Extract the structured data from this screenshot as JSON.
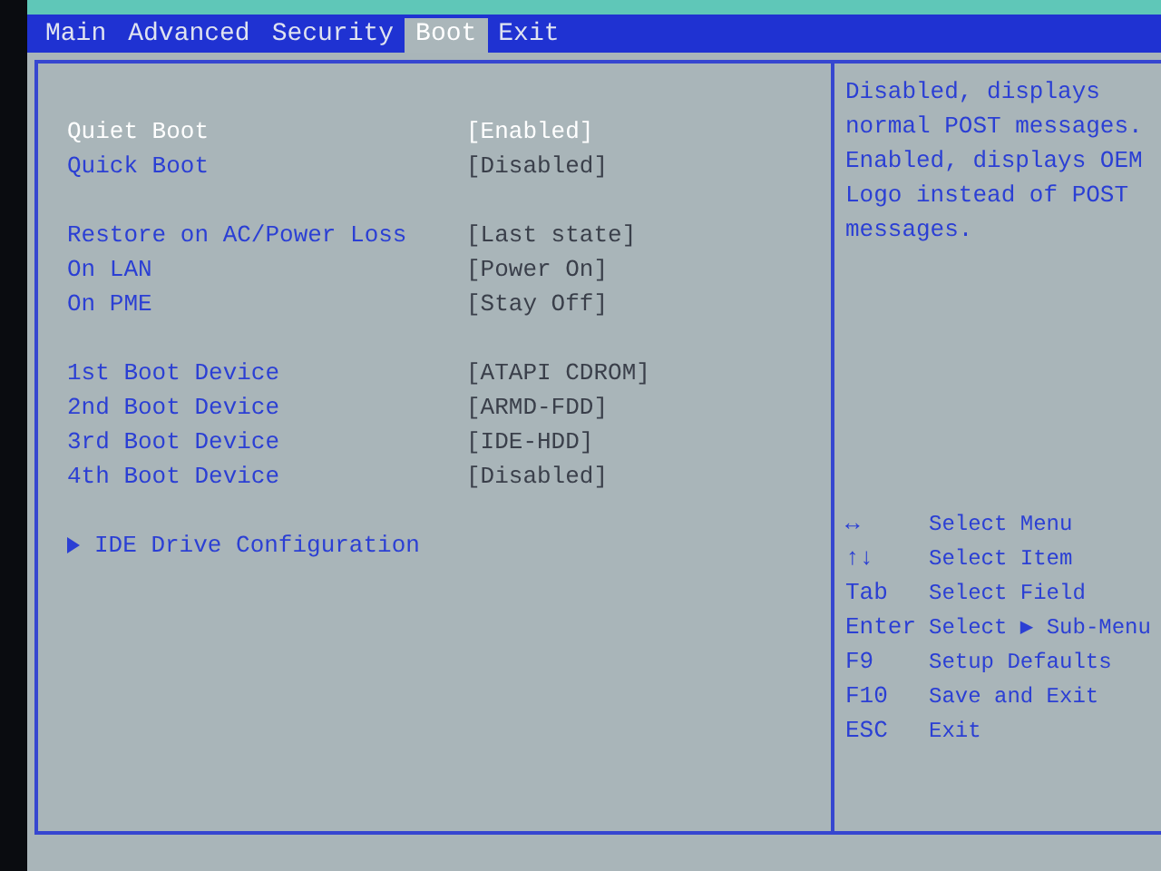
{
  "menu_bar": {
    "tabs": [
      {
        "label": "Main",
        "selected": false
      },
      {
        "label": "Advanced",
        "selected": false
      },
      {
        "label": "Security",
        "selected": false
      },
      {
        "label": "Boot",
        "selected": true
      },
      {
        "label": "Exit",
        "selected": false
      }
    ]
  },
  "settings": {
    "groups": [
      {
        "items": [
          {
            "kind": "option",
            "label": "Quiet Boot",
            "value": "[Enabled]",
            "selected": true
          },
          {
            "kind": "option",
            "label": "Quick Boot",
            "value": "[Disabled]",
            "selected": false
          }
        ]
      },
      {
        "items": [
          {
            "kind": "option",
            "label": "Restore on AC/Power Loss",
            "value": "[Last state]",
            "selected": false
          },
          {
            "kind": "option",
            "label": "On LAN",
            "value": "[Power On]",
            "selected": false
          },
          {
            "kind": "option",
            "label": "On PME",
            "value": "[Stay Off]",
            "selected": false
          }
        ]
      },
      {
        "items": [
          {
            "kind": "option",
            "label": "1st Boot Device",
            "value": "[ATAPI CDROM]",
            "selected": false
          },
          {
            "kind": "option",
            "label": "2nd Boot Device",
            "value": "[ARMD-FDD]",
            "selected": false
          },
          {
            "kind": "option",
            "label": "3rd Boot Device",
            "value": "[IDE-HDD]",
            "selected": false
          },
          {
            "kind": "option",
            "label": "4th Boot Device",
            "value": "[Disabled]",
            "selected": false
          }
        ]
      },
      {
        "items": [
          {
            "kind": "submenu",
            "label": "IDE Drive Configuration",
            "selected": false
          }
        ]
      }
    ]
  },
  "help": {
    "text": "Disabled, displays normal POST messages. Enabled, displays OEM Logo instead of POST messages.",
    "keys": [
      {
        "key": "↔",
        "action": "Select Menu"
      },
      {
        "key": "↑↓",
        "action": "Select Item"
      },
      {
        "key": "Tab",
        "action": "Select Field"
      },
      {
        "key": "Enter",
        "action": "Select ▶ Sub-Menu"
      },
      {
        "key": "F9",
        "action": "Setup Defaults"
      },
      {
        "key": "F10",
        "action": "Save and Exit"
      },
      {
        "key": "ESC",
        "action": "Exit"
      }
    ]
  }
}
